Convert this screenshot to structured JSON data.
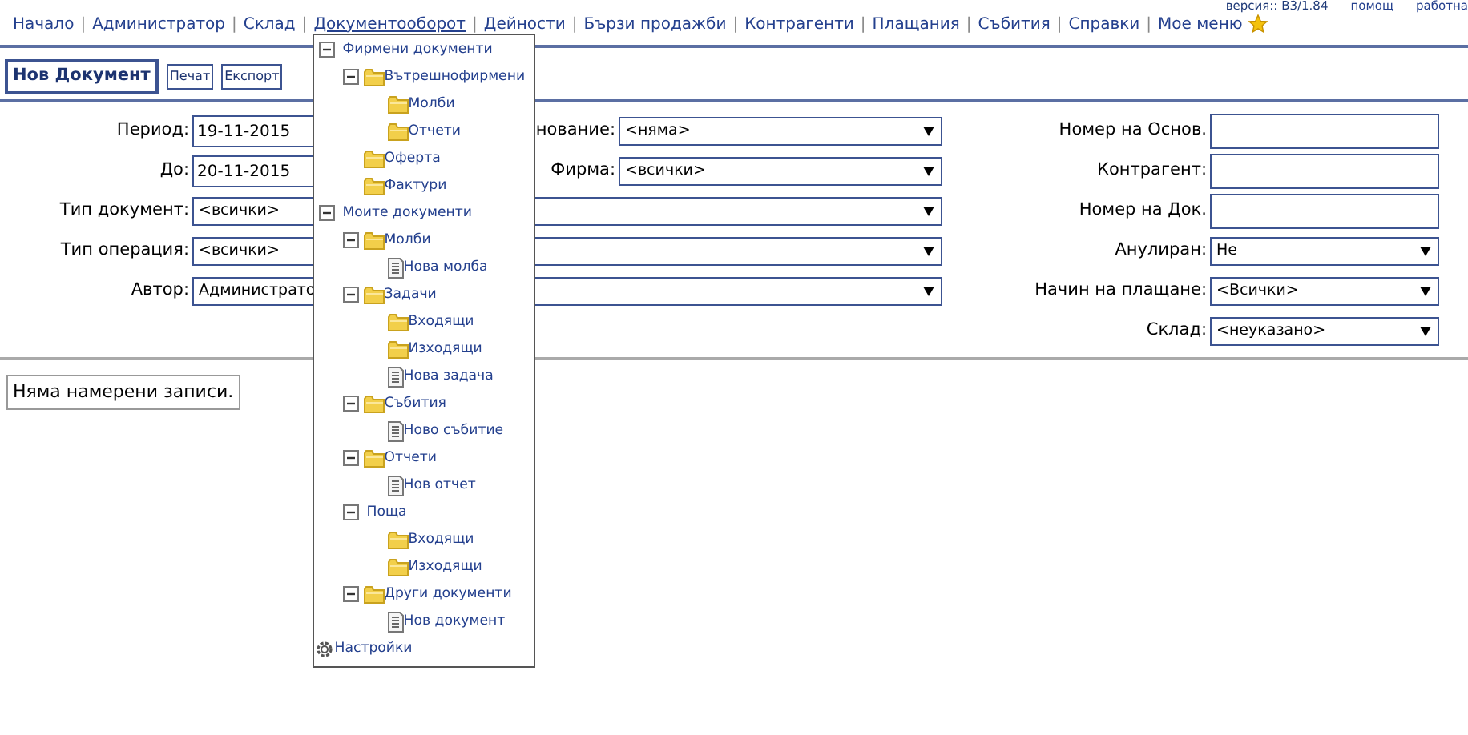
{
  "header": {
    "version": "версия:: B3/1.84",
    "links": [
      "помощ",
      "работна"
    ]
  },
  "nav": {
    "separator": "|",
    "items": [
      {
        "label": "Начало",
        "selected": false
      },
      {
        "label": "Администратор",
        "selected": false
      },
      {
        "label": "Склад",
        "selected": false
      },
      {
        "label": "Документооборот",
        "selected": true
      },
      {
        "label": "Дейности",
        "selected": false
      },
      {
        "label": "Бързи продажби",
        "selected": false
      },
      {
        "label": "Контрагенти",
        "selected": false
      },
      {
        "label": "Плащания",
        "selected": false
      },
      {
        "label": "Събития",
        "selected": false
      },
      {
        "label": "Справки",
        "selected": false
      },
      {
        "label": "Мое меню",
        "selected": false
      }
    ]
  },
  "toolbar": {
    "title": "Нов Документ",
    "buttons": [
      "Печат",
      "Експорт"
    ]
  },
  "form": {
    "left": [
      {
        "label": "Период:",
        "kind": "text",
        "value": "19-11-2015"
      },
      {
        "label": "До:",
        "kind": "text",
        "value": "20-11-2015"
      },
      {
        "label": "Тип документ:",
        "kind": "select",
        "value": "<всички>"
      },
      {
        "label": "Тип операция:",
        "kind": "select",
        "value": "<всички>"
      },
      {
        "label": "Автор:",
        "kind": "select",
        "value": "Администрато"
      }
    ],
    "middle": [
      {
        "label": "нование:",
        "kind": "select",
        "value": "<няма>"
      },
      {
        "label": "Фирма:",
        "kind": "select",
        "value": "<всички>"
      }
    ],
    "right": [
      {
        "label": "Номер на Основ.",
        "kind": "text"
      },
      {
        "label": "Контрагент:",
        "kind": "text"
      },
      {
        "label": "Номер на Док.",
        "kind": "text"
      },
      {
        "label": "Анулиран:",
        "kind": "select",
        "value": "Не"
      },
      {
        "label": "Начин на плащане:",
        "kind": "select",
        "value": "<Всички>"
      },
      {
        "label": "Склад:",
        "kind": "select",
        "value": "<неуказано>"
      }
    ]
  },
  "results": {
    "message": "Няма намерени записи."
  },
  "menu": {
    "tree": [
      {
        "label": "Фирмени документи",
        "kind": "group",
        "expanded": true,
        "children": [
          {
            "label": "Вътрешнофирмени",
            "kind": "folder",
            "expanded": true,
            "children": [
              {
                "label": "Молби",
                "kind": "folder"
              },
              {
                "label": "Отчети",
                "kind": "folder"
              }
            ]
          },
          {
            "label": "Оферта",
            "kind": "folder"
          },
          {
            "label": "Фактури",
            "kind": "folder"
          }
        ]
      },
      {
        "label": "Моите документи",
        "kind": "group",
        "expanded": true,
        "children": [
          {
            "label": "Молби",
            "kind": "folder",
            "expanded": true,
            "children": [
              {
                "label": "Нова молба",
                "kind": "document"
              }
            ]
          },
          {
            "label": "Задачи",
            "kind": "folder",
            "expanded": true,
            "children": [
              {
                "label": "Входящи",
                "kind": "folder"
              },
              {
                "label": "Изходящи",
                "kind": "folder"
              },
              {
                "label": "Нова задача",
                "kind": "document"
              }
            ]
          },
          {
            "label": "Събития",
            "kind": "folder",
            "expanded": true,
            "children": [
              {
                "label": "Ново събитие",
                "kind": "document"
              }
            ]
          },
          {
            "label": "Отчети",
            "kind": "folder",
            "expanded": true,
            "children": [
              {
                "label": "Нов отчет",
                "kind": "document"
              }
            ]
          },
          {
            "label": "Поща",
            "kind": "group",
            "expanded": true,
            "children": [
              {
                "label": "Входящи",
                "kind": "folder"
              },
              {
                "label": "Изходящи",
                "kind": "folder"
              }
            ]
          },
          {
            "label": "Други документи",
            "kind": "folder",
            "expanded": true,
            "children": [
              {
                "label": "Нов документ",
                "kind": "document"
              }
            ]
          }
        ]
      }
    ],
    "settings": "Настройки"
  }
}
